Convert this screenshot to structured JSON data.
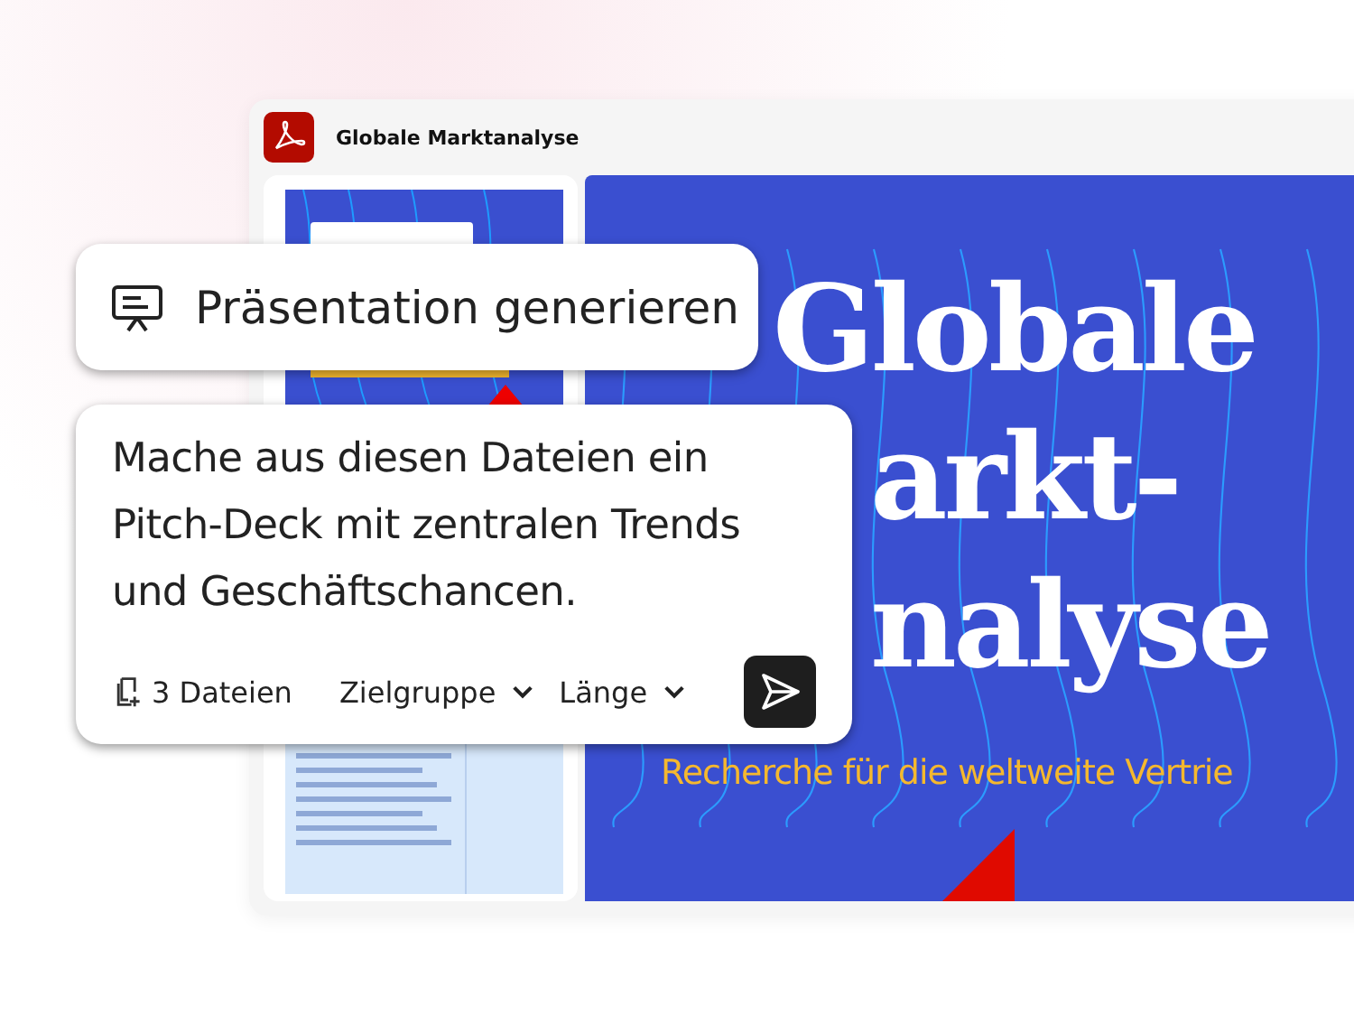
{
  "window": {
    "title": "Globale Marktanalyse"
  },
  "slide": {
    "title_lines": [
      "Globale",
      "arkt-",
      "nalyse"
    ],
    "subtitle": "Recherche für die weltweite Vertrie"
  },
  "action_chip": {
    "label": "Präsentation generieren"
  },
  "prompt": {
    "text": "Mache aus diesen Dateien ein Pitch-Deck mit zentralen Trends und Geschäftschancen.",
    "attachments": "3 Dateien",
    "options": [
      {
        "label": "Zielgruppe"
      },
      {
        "label": "Länge"
      }
    ]
  }
}
